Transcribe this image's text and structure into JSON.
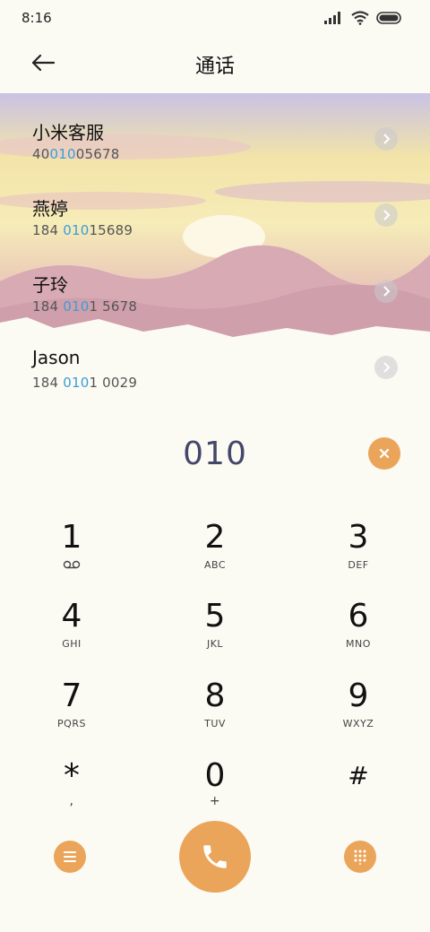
{
  "status_bar": {
    "time": "8:16"
  },
  "header": {
    "title": "通话"
  },
  "colors": {
    "accent": "#eaa55a",
    "highlight": "#3a9ed8",
    "typed": "#45476a",
    "background": "#fbfaf3"
  },
  "contacts": [
    {
      "name": "小米客服",
      "number_pre": "40",
      "number_match": "010",
      "number_post": "05678"
    },
    {
      "name": "燕婷",
      "number_pre": "184 ",
      "number_match": "010",
      "number_post": "15689"
    },
    {
      "name": "子玲",
      "number_pre": "184 ",
      "number_match": "010",
      "number_post": "1 5678"
    },
    {
      "name": "Jason",
      "number_pre": "184 ",
      "number_match": "010",
      "number_post": "1 0029"
    }
  ],
  "dialer": {
    "typed_number": "010"
  },
  "keypad": [
    {
      "digit": "1",
      "letters": ""
    },
    {
      "digit": "2",
      "letters": "ABC"
    },
    {
      "digit": "3",
      "letters": "DEF"
    },
    {
      "digit": "4",
      "letters": "GHI"
    },
    {
      "digit": "5",
      "letters": "JKL"
    },
    {
      "digit": "6",
      "letters": "MNO"
    },
    {
      "digit": "7",
      "letters": "PQRS"
    },
    {
      "digit": "8",
      "letters": "TUV"
    },
    {
      "digit": "9",
      "letters": "WXYZ"
    },
    {
      "digit": "*",
      "letters": ","
    },
    {
      "digit": "0",
      "letters": "+"
    },
    {
      "digit": "#",
      "letters": ""
    }
  ],
  "icons": {
    "back": "arrow-left-icon",
    "clear": "close-icon",
    "voicemail": "voicemail-icon",
    "menu": "menu-icon",
    "call": "phone-icon",
    "keypad_toggle": "dialpad-icon"
  }
}
